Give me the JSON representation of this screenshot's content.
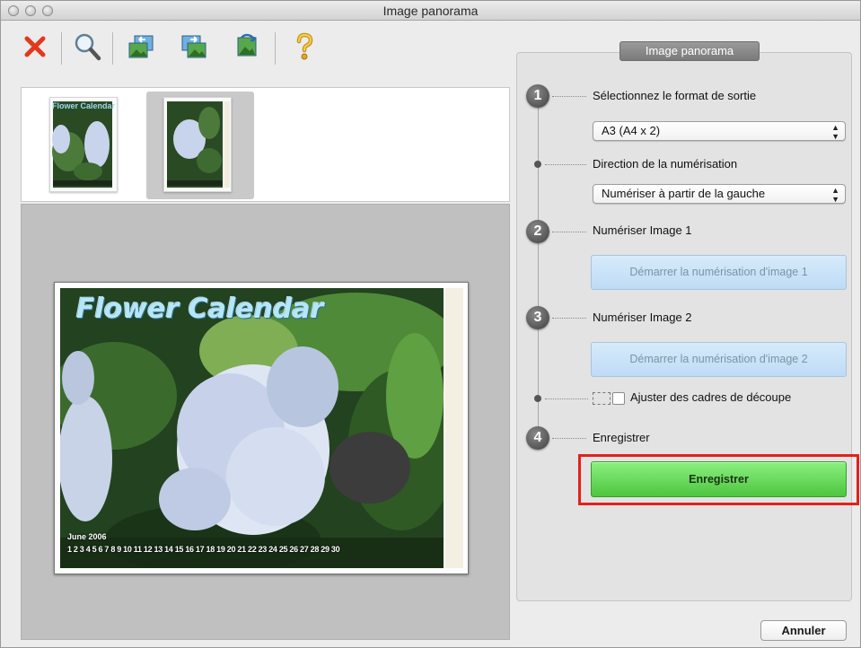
{
  "window": {
    "title": "Image panorama"
  },
  "toolbar": {
    "items": [
      {
        "icon": "delete-icon",
        "tooltip": ""
      },
      {
        "icon": "zoom-icon",
        "tooltip": ""
      },
      {
        "icon": "swap-left-icon",
        "tooltip": ""
      },
      {
        "icon": "swap-right-icon",
        "tooltip": ""
      },
      {
        "icon": "rotate-icon",
        "tooltip": ""
      },
      {
        "icon": "help-icon",
        "tooltip": ""
      }
    ]
  },
  "thumbnails": {
    "items": [
      {
        "caption": "Flower Calendar",
        "selected": false
      },
      {
        "caption": "",
        "selected": true
      }
    ]
  },
  "preview": {
    "title": "Flower Calendar",
    "month": "June 2006",
    "days": "1 2 3 4 5 6 7 8 9 10 11 12 13 14 15 16 17 18 19 20 21 22 23 24 25 26 27 28 29 30"
  },
  "panel": {
    "tab_title": "Image panorama",
    "step1": {
      "number": "1",
      "label": "Sélectionnez le format de sortie",
      "format_value": "A3 (A4 x 2)"
    },
    "direction": {
      "label": "Direction de la numérisation",
      "value": "Numériser à partir de la gauche"
    },
    "step2": {
      "number": "2",
      "label": "Numériser Image 1",
      "button": "Démarrer la numérisation d'image 1"
    },
    "step3": {
      "number": "3",
      "label": "Numériser Image 2",
      "button": "Démarrer la numérisation d'image 2"
    },
    "crop": {
      "label": "Ajuster des cadres de découpe",
      "checked": false
    },
    "step4": {
      "number": "4",
      "label": "Enregistrer",
      "button": "Enregistrer"
    }
  },
  "footer": {
    "cancel": "Annuler"
  },
  "colors": {
    "highlight": "#e4201c",
    "save_button": "#4ec540",
    "scan_button": "#bedbf5"
  }
}
